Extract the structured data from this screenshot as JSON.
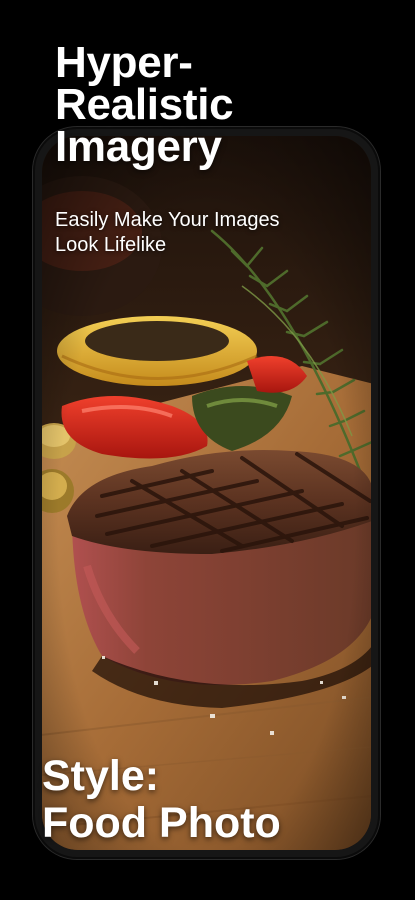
{
  "headline": {
    "line1": "Hyper-",
    "line2": "Realistic",
    "line3": "Imagery"
  },
  "subtitle": {
    "line1": "Easily Make Your Images",
    "line2": "Look Lifelike"
  },
  "style_label": {
    "line1": "Style:",
    "line2": "Food Photo"
  },
  "colors": {
    "background": "#000000",
    "text": "#ffffff",
    "board": "#b07a44",
    "steak_crust": "#5a3320",
    "steak_inside": "#9c4a45",
    "pepper_red": "#d2261b",
    "pepper_yellow": "#e6b431",
    "rosemary": "#6f8a3c"
  },
  "image": {
    "subject": "grilled-steak-with-vegetables-and-rosemary-icon"
  }
}
